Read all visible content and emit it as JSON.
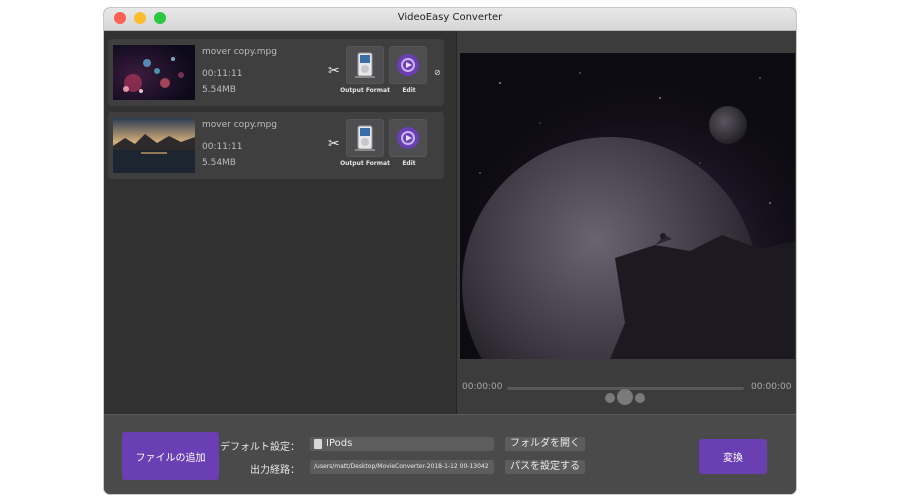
{
  "window": {
    "title": "VideoEasy Converter"
  },
  "files": [
    {
      "name": "mover copy.mpg",
      "duration": "00:11:11",
      "size": "5.54MB"
    },
    {
      "name": "mover copy.mpg",
      "duration": "00:11:11",
      "size": "5.54MB"
    }
  ],
  "item_buttons": {
    "format_label": "Output Format",
    "edit_label": "Edit"
  },
  "player": {
    "current_time": "00:00:00",
    "total_time": "00:00:00",
    "progress": 0
  },
  "bottom": {
    "add_button": "ファイルの追加",
    "default_label": "デフォルト設定：",
    "default_value": "IPods",
    "path_label": "出力経路：",
    "path_value": "/users/matt/Desktop/MovieConverter-2018-1-12 00-13042",
    "open_folder": "フォルダを開く",
    "set_path": "パスを設定する",
    "convert_button": "変換"
  },
  "colors": {
    "accent": "#6a3fb4",
    "window_bg": "#3a3a3b",
    "item_bg": "#3f3f40"
  },
  "icons": [
    "scissors-icon",
    "ipod-icon",
    "edit-icon",
    "info-icon",
    "ipod-small-icon"
  ]
}
